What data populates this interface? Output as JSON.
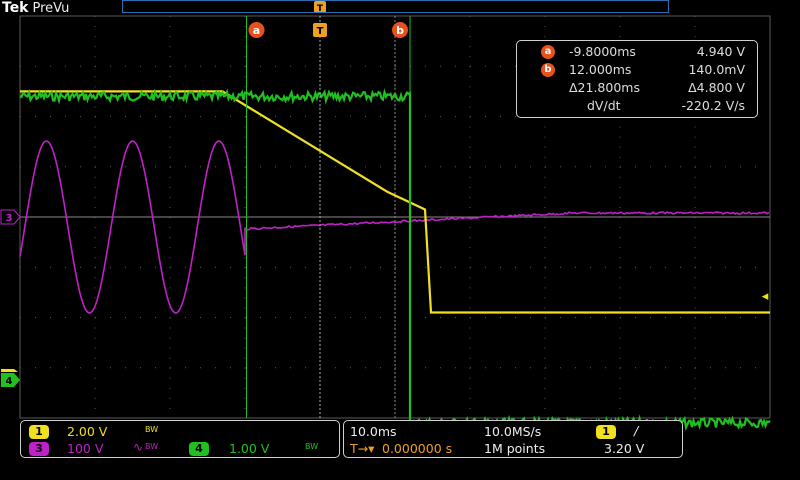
{
  "app": {
    "brand": "Tek",
    "mode": "PreVu"
  },
  "colors": {
    "ch1": "#f0e020",
    "ch3": "#c020c8",
    "ch4": "#20c020",
    "cursor": "#e8501c",
    "trigger": "#f0a020",
    "grid": "#5a5a5a"
  },
  "cursors": {
    "a": {
      "label": "a",
      "time": "-9.8000ms",
      "value": "4.940 V",
      "time_ms": -9.8
    },
    "b": {
      "label": "b",
      "time": "12.000ms",
      "value": "140.0mV",
      "time_ms": 12.0
    },
    "delta": {
      "time": "Δ21.800ms",
      "value": "Δ4.800 V"
    },
    "rate": {
      "label": "dV/dt",
      "value": "-220.2 V/s"
    }
  },
  "trigger": {
    "marker": "T",
    "top_marker": "T",
    "level_arrow": "◂"
  },
  "channels": {
    "ch1": {
      "label": "1",
      "scale": "2.00 V",
      "bw": "BW"
    },
    "ch3": {
      "label": "3",
      "scale": "100 V",
      "bw": "BW",
      "coupling_icon": "ac-coupling-icon",
      "coupling_glyph": "∿"
    },
    "ch4": {
      "label": "4",
      "scale": "1.00 V",
      "bw": "BW"
    }
  },
  "timebase": {
    "scale": "10.0ms",
    "sample_rate": "10.0MS/s",
    "record_length": "1M points",
    "trigger_position": "0.000000 s",
    "trigger_position_prefix": "T→▾",
    "trigger_source": "1",
    "trigger_slope": "/",
    "trigger_level": "3.20 V"
  },
  "chart_data": {
    "type": "line",
    "xlabel": "",
    "ylabel": "",
    "x_unit": "ms",
    "xlim": [
      -40,
      60
    ],
    "divisions": {
      "x": 10,
      "y": 8
    },
    "series": [
      {
        "channel": "ch1",
        "points": [
          [
            -40,
            5.0
          ],
          [
            -13,
            5.0
          ],
          [
            9,
            1.0
          ],
          [
            14,
            0.3
          ],
          [
            14.8,
            -3.8
          ],
          [
            60,
            -3.8
          ]
        ]
      },
      {
        "channel": "ch3",
        "type": "sine_then_flat",
        "amplitude_div": 1.8,
        "period_ms": 11.5,
        "cut_ms": -10
      },
      {
        "channel": "ch4",
        "points": [
          [
            -40,
            2.4
          ],
          [
            12,
            2.4
          ],
          [
            12,
            -4.1
          ],
          [
            60,
            -4.1
          ]
        ]
      }
    ]
  }
}
